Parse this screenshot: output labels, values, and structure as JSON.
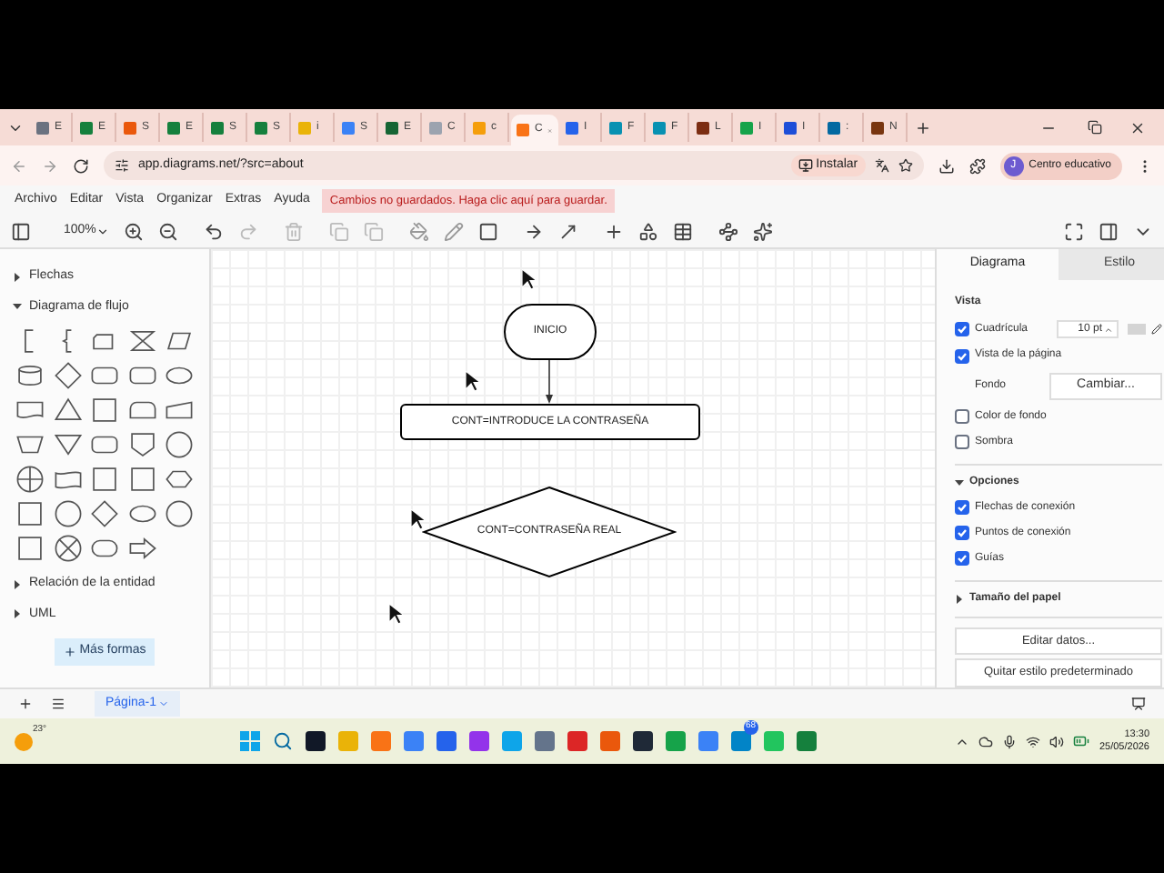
{
  "browser": {
    "tabs": [
      {
        "label": "E",
        "color": "#6b7280",
        "selected": false
      },
      {
        "label": "E",
        "color": "#15803d",
        "selected": false
      },
      {
        "label": "S",
        "color": "#ea580c",
        "selected": false
      },
      {
        "label": "E",
        "color": "#15803d",
        "selected": false
      },
      {
        "label": "S",
        "color": "#15803d",
        "selected": false
      },
      {
        "label": "S",
        "color": "#15803d",
        "selected": false
      },
      {
        "label": "i",
        "color": "#eab308",
        "selected": false
      },
      {
        "label": "S",
        "color": "#3b82f6",
        "selected": false
      },
      {
        "label": "E",
        "color": "#166534",
        "selected": false
      },
      {
        "label": "C",
        "color": "#9ca3af",
        "selected": false
      },
      {
        "label": "c",
        "color": "#f59e0b",
        "selected": false
      },
      {
        "label": "C",
        "color": "#f97316",
        "selected": true
      },
      {
        "label": "I",
        "color": "#2563eb",
        "selected": false
      },
      {
        "label": "F",
        "color": "#0891b2",
        "selected": false
      },
      {
        "label": "F",
        "color": "#0891b2",
        "selected": false
      },
      {
        "label": "L",
        "color": "#7c2d12",
        "selected": false
      },
      {
        "label": "I",
        "color": "#16a34a",
        "selected": false
      },
      {
        "label": "I",
        "color": "#1d4ed8",
        "selected": false
      },
      {
        "label": ":",
        "color": "#0369a1",
        "selected": false
      },
      {
        "label": "N",
        "color": "#78350f",
        "selected": false
      }
    ],
    "url": "app.diagrams.net/?src=about",
    "install": "Instalar",
    "avatar_letter": "J",
    "profile": "Centro educativo"
  },
  "menu": {
    "items": [
      "Archivo",
      "Editar",
      "Vista",
      "Organizar",
      "Extras",
      "Ayuda"
    ],
    "notice": "Cambios no guardados. Haga clic aquí para guardar."
  },
  "toolbar": {
    "zoom": "100%"
  },
  "sidebar": {
    "sections": [
      {
        "title": "Flechas",
        "expanded": false
      },
      {
        "title": "Diagrama de flujo",
        "expanded": true
      },
      {
        "title": "Relación de la entidad",
        "expanded": false
      },
      {
        "title": "UML",
        "expanded": false
      }
    ],
    "more_shapes": "Más formas"
  },
  "diagram": {
    "nodes": [
      {
        "kind": "terminator",
        "text": "INICIO"
      },
      {
        "kind": "process",
        "text": "CONT=INTRODUCE LA CONTRASEÑA"
      },
      {
        "kind": "decision",
        "text": "CONT=CONTRASEÑA REAL"
      }
    ]
  },
  "panel": {
    "tabs": [
      {
        "label": "Diagrama",
        "selected": true
      },
      {
        "label": "Estilo",
        "selected": false
      }
    ],
    "view_title": "Vista",
    "grid": {
      "label": "Cuadrícula",
      "checked": true,
      "size": "10 pt"
    },
    "page_view": {
      "label": "Vista de la página",
      "checked": true
    },
    "background": {
      "label": "Fondo",
      "button": "Cambiar..."
    },
    "toggles": [
      {
        "label": "Color de fondo",
        "checked": false
      },
      {
        "label": "Sombra",
        "checked": false
      }
    ],
    "options": {
      "title": "Opciones",
      "expanded": true,
      "items": [
        {
          "label": "Flechas de conexión",
          "checked": true
        },
        {
          "label": "Puntos de conexión",
          "checked": true
        },
        {
          "label": "Guías",
          "checked": true
        }
      ]
    },
    "paper": {
      "title": "Tamaño del papel",
      "expanded": false
    },
    "buttons": [
      "Editar datos...",
      "Quitar estilo predeterminado"
    ]
  },
  "pages": {
    "tabs": [
      {
        "label": "Página-1",
        "selected": true
      }
    ]
  },
  "taskbar": {
    "weather": "23°",
    "badge": "68",
    "time": "13:30",
    "date": "25/05/2026"
  }
}
